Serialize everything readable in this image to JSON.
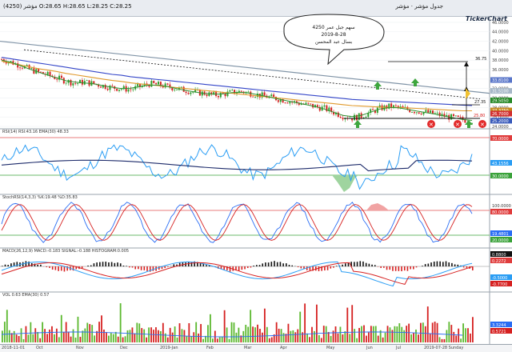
{
  "toolbar": {
    "left_text": "مؤشر (4250)  O:28.65  H:28.65  L:28.25  C:28.25",
    "right_text": "جدول  مؤشر  ·  مؤشر"
  },
  "brand": "TickerChart",
  "annotation": {
    "line1": "سهم جبل عمر 4250",
    "line2": "2019-8-28",
    "line3": "بسال عبد المحسن"
  },
  "price_labels": [
    "36.75",
    "27.35",
    "25.80"
  ],
  "sell_marks": [
    "✕",
    "✕",
    "✕",
    "✕"
  ],
  "right_axis_ticks": [
    "46.0000",
    "44.0000",
    "42.0000",
    "40.0000",
    "38.0000",
    "36.0000",
    "34.0000",
    "32.0000",
    "30.0000",
    "28.0000",
    "26.0000",
    "24.0000"
  ],
  "badges": [
    {
      "text": "33.8100",
      "color": "#5a76c9"
    },
    {
      "text": "31.5100",
      "color": "#a7b8c8"
    },
    {
      "text": "29.5050",
      "color": "#2a8a2a"
    },
    {
      "text": "27.3750",
      "color": "#c58a1f"
    },
    {
      "text": "26.7000",
      "color": "#d23030"
    },
    {
      "text": "25.2000",
      "color": "#3a5bbb"
    }
  ],
  "rsi": {
    "header": "RSI(14)  RSI:43.16  EMA(30)  48.33",
    "ticks": [
      "70.0000",
      "30.0000"
    ],
    "badges": [
      "70.0000",
      "43.1556",
      "30.0000"
    ]
  },
  "stoch": {
    "header": "StochRSI(14,3,3)  %K:19.48  %D:35.83",
    "ticks": [
      "80.0000",
      "20.0000"
    ],
    "badges": [
      "100.0000",
      "80.0000",
      "19.4801",
      "20.0000"
    ]
  },
  "macd": {
    "header": "MACD(26,12,9)  MACD:-0.183  SIGNAL:-0.188  HISTOGRAM:0.005",
    "badges": [
      "0.8800",
      "0.2272",
      "-0.5000",
      "-0.7700"
    ]
  },
  "vol": {
    "header": "VOL  0.63  EMA(30)  0.57",
    "badges": [
      "3.3244",
      "0.5721"
    ]
  },
  "x_labels": [
    "2018-11-01",
    "Oct",
    "Nov",
    "Dec",
    "2019-Jan",
    "Feb",
    "Mar",
    "Apr",
    "May",
    "Jun",
    "Jul",
    "2019-07-28 Sunday"
  ],
  "chart_data": {
    "type": "line",
    "symbol": "4250",
    "date": "2019-8-28",
    "series": [
      {
        "name": "Close",
        "values": [
          38.2,
          37.6,
          36.9,
          36.1,
          35.4,
          34.9,
          34.2,
          33.6,
          33.1,
          33.4,
          33.0,
          32.6,
          32.2,
          32.0,
          31.8,
          32.4,
          33.0,
          32.8,
          32.4,
          32.0,
          31.6,
          31.2,
          31.0,
          30.6,
          30.8,
          31.2,
          31.4,
          31.0,
          30.6,
          30.2,
          29.8,
          29.4,
          29.0,
          28.6,
          28.2,
          27.8,
          27.0,
          26.2,
          25.8,
          26.2,
          27.0,
          27.8,
          28.2,
          28.0,
          27.6,
          27.2,
          27.0,
          26.6,
          26.2,
          25.8,
          25.4,
          25.2
        ]
      },
      {
        "name": "MA(50)",
        "values": [
          37.8,
          37.4,
          37.0,
          36.6,
          36.2,
          35.9,
          35.6,
          35.2,
          34.9,
          34.6,
          34.3,
          34.0,
          33.7,
          33.5,
          33.2,
          33.0,
          32.8,
          32.6,
          32.4,
          32.2,
          32.0,
          31.8,
          31.6,
          31.4,
          31.2,
          31.0,
          30.8,
          30.6,
          30.4,
          30.2,
          30.0,
          29.8,
          29.6,
          29.4,
          29.2,
          29.0,
          28.8,
          28.6,
          28.4,
          28.3,
          28.2,
          28.1,
          28.0,
          28.0,
          27.9,
          27.8,
          27.7,
          27.6,
          27.5,
          27.4,
          27.3,
          27.3
        ]
      },
      {
        "name": "MA(100)",
        "values": [
          38.6,
          38.3,
          38.0,
          37.7,
          37.4,
          37.1,
          36.8,
          36.5,
          36.2,
          35.9,
          35.6,
          35.3,
          35.0,
          34.8,
          34.5,
          34.3,
          34.1,
          33.9,
          33.7,
          33.5,
          33.3,
          33.1,
          32.9,
          32.7,
          32.5,
          32.3,
          32.1,
          31.9,
          31.7,
          31.5,
          31.3,
          31.1,
          30.9,
          30.7,
          30.5,
          30.3,
          30.1,
          29.9,
          29.7,
          29.6,
          29.5,
          29.4,
          29.3,
          29.2,
          29.1,
          29.0,
          28.9,
          28.8,
          28.7,
          28.6,
          28.5,
          28.4
        ]
      }
    ],
    "ylim": [
      24,
      47
    ],
    "grid": true
  }
}
